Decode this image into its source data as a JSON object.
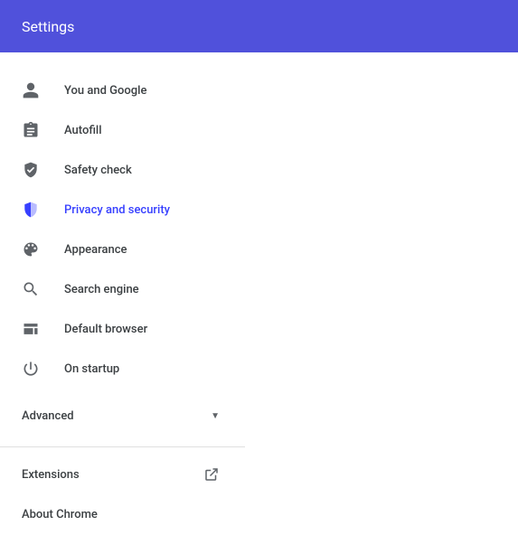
{
  "header": {
    "title": "Settings"
  },
  "sidebar": {
    "items": [
      {
        "label": "You and Google"
      },
      {
        "label": "Autofill"
      },
      {
        "label": "Safety check"
      },
      {
        "label": "Privacy and security"
      },
      {
        "label": "Appearance"
      },
      {
        "label": "Search engine"
      },
      {
        "label": "Default browser"
      },
      {
        "label": "On startup"
      }
    ],
    "advanced": {
      "label": "Advanced"
    },
    "extensions": {
      "label": "Extensions"
    },
    "about": {
      "label": "About Chrome"
    },
    "active_index": 3
  }
}
